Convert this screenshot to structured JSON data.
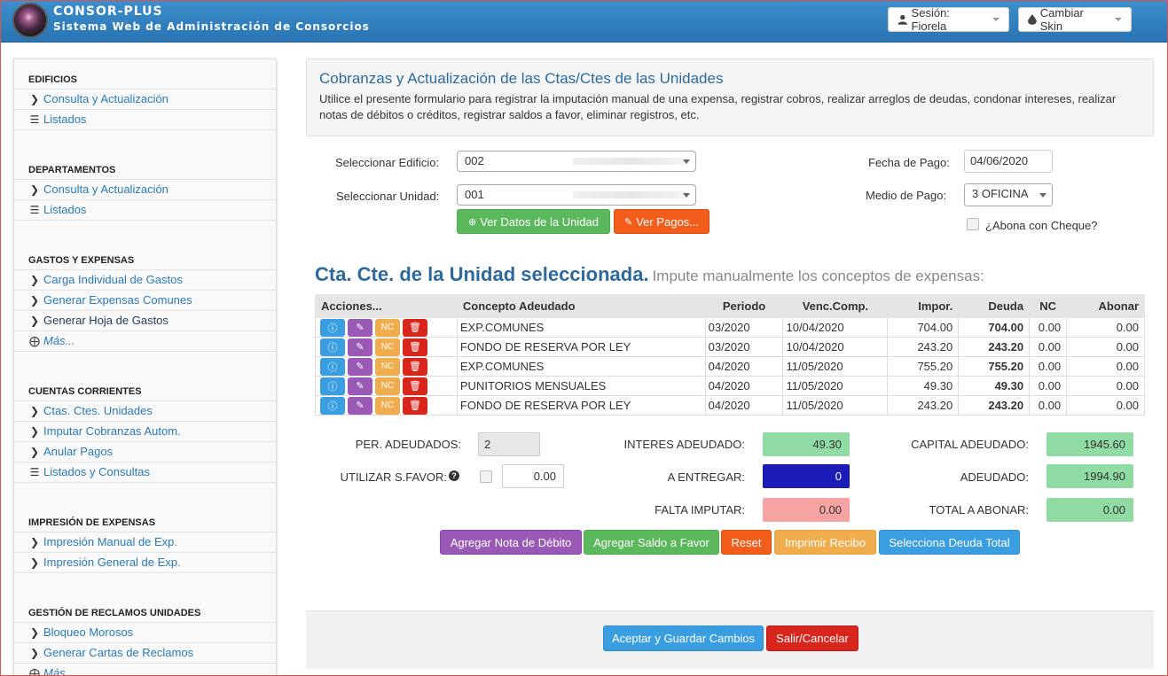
{
  "header": {
    "title": "CONSOR-PLUS",
    "subtitle": "Sistema Web de Administración de Consorcios",
    "session_label": "Sesión: Fiorela",
    "skin_label": "Cambiar Skin"
  },
  "sidebar": {
    "sections": [
      {
        "title": "EDIFICIOS",
        "items": [
          {
            "label": "Consulta y Actualización",
            "icon": "chevron-right-icon"
          },
          {
            "label": "Listados",
            "icon": "list-icon"
          }
        ]
      },
      {
        "title": "DEPARTAMENTOS",
        "items": [
          {
            "label": "Consulta y Actualización",
            "icon": "chevron-right-icon"
          },
          {
            "label": "Listados",
            "icon": "list-icon"
          }
        ]
      },
      {
        "title": "GASTOS Y EXPENSAS",
        "items": [
          {
            "label": "Carga Individual de Gastos",
            "icon": "chevron-right-icon"
          },
          {
            "label": "Generar Expensas Comunes",
            "icon": "chevron-right-icon"
          },
          {
            "label": "Generar Hoja de Gastos",
            "icon": "chevron-right-icon"
          },
          {
            "label": "Más...",
            "icon": "plus-circle-icon"
          }
        ]
      },
      {
        "title": "CUENTAS CORRIENTES",
        "items": [
          {
            "label": "Ctas. Ctes. Unidades",
            "icon": "chevron-right-icon"
          },
          {
            "label": "Imputar Cobranzas Autom.",
            "icon": "chevron-right-icon"
          },
          {
            "label": "Anular Pagos",
            "icon": "chevron-right-icon"
          },
          {
            "label": "Listados y Consultas",
            "icon": "list-icon"
          }
        ]
      },
      {
        "title": "IMPRESIÓN DE EXPENSAS",
        "items": [
          {
            "label": "Impresión Manual de Exp.",
            "icon": "chevron-right-icon"
          },
          {
            "label": "Impresión General de Exp.",
            "icon": "chevron-right-icon"
          }
        ]
      },
      {
        "title": "GESTIÓN DE RECLAMOS UNIDADES",
        "items": [
          {
            "label": "Bloqueo Morosos",
            "icon": "chevron-right-icon"
          },
          {
            "label": "Generar Cartas de Reclamos",
            "icon": "chevron-right-icon"
          },
          {
            "label": "Más...",
            "icon": "plus-circle-icon"
          }
        ]
      }
    ]
  },
  "panel": {
    "title": "Cobranzas y Actualización de las Ctas/Ctes de las Unidades",
    "description": "Utilice el presente formulario para registrar la imputación manual de una expensa, registrar cobros, realizar arreglos de deudas, condonar intereses, realizar notas de débitos o créditos, registrar saldos a favor, eliminar registros, etc."
  },
  "form": {
    "edificio_label": "Seleccionar Edificio:",
    "edificio_value": "002",
    "unidad_label": "Seleccionar Unidad:",
    "unidad_value": "001",
    "fecha_label": "Fecha de Pago:",
    "fecha_value": "04/06/2020",
    "medio_label": "Medio de Pago:",
    "medio_value": "3 OFICINA",
    "cheque_label": "¿Abona con Cheque?",
    "ver_datos_label": "Ver Datos de la Unidad",
    "ver_pagos_label": "Ver Pagos..."
  },
  "section": {
    "title": "Cta. Cte. de la Unidad seleccionada.",
    "subtitle": "Impute manualmente los conceptos de expensas:"
  },
  "table": {
    "headers": [
      "Acciones...",
      "Concepto Adeudado",
      "Periodo",
      "Venc.Comp.",
      "Impor.",
      "Deuda",
      "NC",
      "Abonar"
    ],
    "nc_label": "NC",
    "rows": [
      {
        "concepto": "EXP.COMUNES",
        "periodo": "03/2020",
        "venc": "10/04/2020",
        "importe": "704.00",
        "deuda": "704.00",
        "nc": "0.00",
        "abonar": "0.00"
      },
      {
        "concepto": "FONDO DE RESERVA POR LEY",
        "periodo": "03/2020",
        "venc": "10/04/2020",
        "importe": "243.20",
        "deuda": "243.20",
        "nc": "0.00",
        "abonar": "0.00"
      },
      {
        "concepto": "EXP.COMUNES",
        "periodo": "04/2020",
        "venc": "11/05/2020",
        "importe": "755.20",
        "deuda": "755.20",
        "nc": "0.00",
        "abonar": "0.00"
      },
      {
        "concepto": "PUNITORIOS MENSUALES",
        "periodo": "04/2020",
        "venc": "11/05/2020",
        "importe": "49.30",
        "deuda": "49.30",
        "nc": "0.00",
        "abonar": "0.00"
      },
      {
        "concepto": "FONDO DE RESERVA POR LEY",
        "periodo": "04/2020",
        "venc": "11/05/2020",
        "importe": "243.20",
        "deuda": "243.20",
        "nc": "0.00",
        "abonar": "0.00"
      }
    ]
  },
  "summary": {
    "per_adeudados_label": "PER. ADEUDADOS:",
    "per_adeudados_value": "2",
    "sfavor_label": "UTILIZAR S.FAVOR:",
    "sfavor_value": "0.00",
    "interes_label": "INTERES ADEUDADO:",
    "interes_value": "49.30",
    "entregar_label": "A ENTREGAR:",
    "entregar_value": "0",
    "falta_label": "FALTA IMPUTAR:",
    "falta_value": "0.00",
    "capital_label": "CAPITAL ADEUDADO:",
    "capital_value": "1945.60",
    "adeudado_label": "ADEUDADO:",
    "adeudado_value": "1994.90",
    "total_label": "TOTAL A ABONAR:",
    "total_value": "0.00"
  },
  "actions": {
    "nota_debito": "Agregar Nota de Débito",
    "saldo_favor": "Agregar Saldo a Favor",
    "reset": "Reset",
    "imprimir": "Imprimir Recibo",
    "deuda_total": "Selecciona Deuda Total"
  },
  "footer": {
    "aceptar": "Aceptar y Guardar Cambios",
    "salir": "Salir/Cancelar"
  }
}
